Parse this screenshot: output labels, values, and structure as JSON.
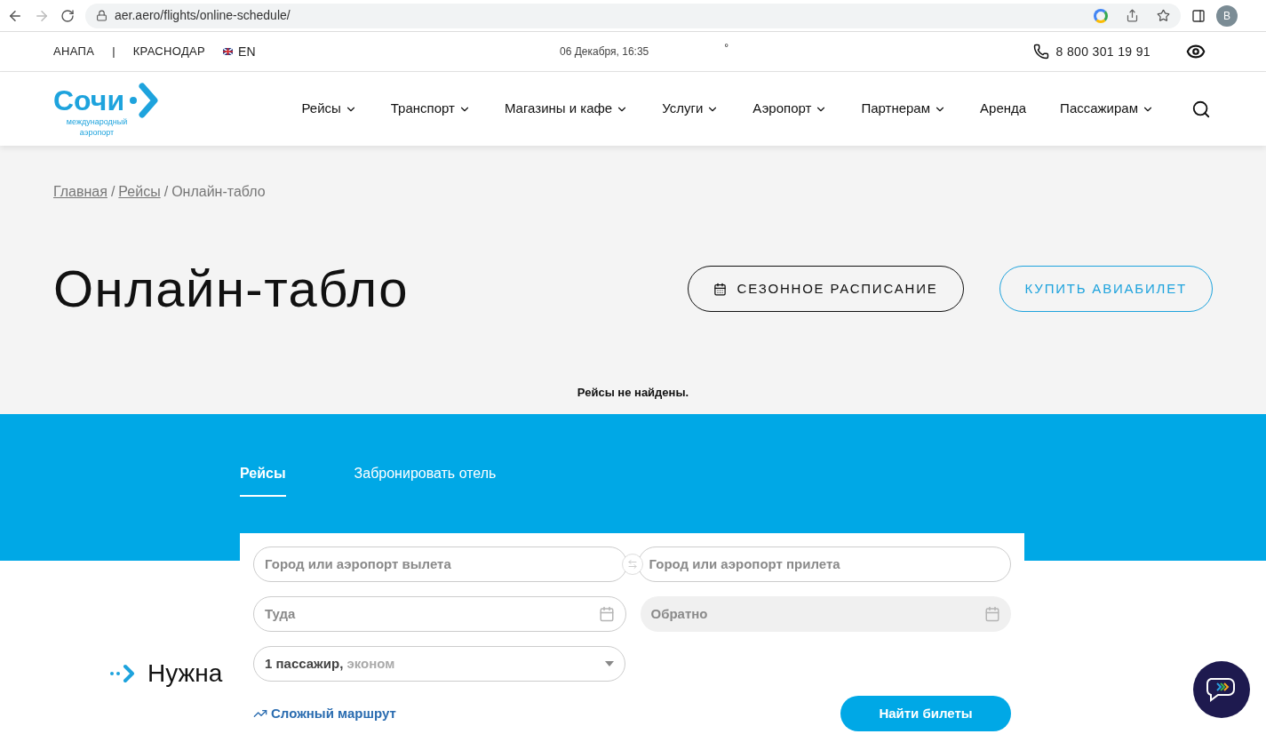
{
  "browser": {
    "url": "aer.aero/flights/online-schedule/",
    "profile_initial": "B"
  },
  "topbar": {
    "cities": [
      "АНАПА",
      "КРАСНОДАР"
    ],
    "separator": "|",
    "language": "EN",
    "datetime": "06 Декабря, 16:35",
    "temperature": "°",
    "phone": "8 800 301 19 91"
  },
  "logo": {
    "name": "Сочи",
    "subtitle": "международный аэропорт"
  },
  "nav": [
    {
      "label": "Рейсы",
      "dropdown": true
    },
    {
      "label": "Транспорт",
      "dropdown": true
    },
    {
      "label": "Магазины и кафе",
      "dropdown": true
    },
    {
      "label": "Услуги",
      "dropdown": true
    },
    {
      "label": "Аэропорт",
      "dropdown": true
    },
    {
      "label": "Партнерам",
      "dropdown": true
    },
    {
      "label": "Аренда",
      "dropdown": false
    },
    {
      "label": "Пассажирам",
      "dropdown": true
    }
  ],
  "breadcrumbs": [
    {
      "kind": "link",
      "label": "Главная"
    },
    {
      "kind": "separator",
      "label": "/"
    },
    {
      "kind": "link",
      "label": "Рейсы"
    },
    {
      "kind": "separator",
      "label": "/"
    },
    {
      "kind": "current",
      "label": "Онлайн-табло"
    }
  ],
  "title": "Онлайн-табло",
  "buttons": [
    {
      "label": "СЕЗОННОЕ РАСПИСАНИЕ",
      "kind": "dark"
    },
    {
      "label": "КУПИТЬ АВИАБИЛЕТ",
      "kind": "blue"
    }
  ],
  "status_message": "Рейсы не найдены.",
  "search_tabs": [
    {
      "label": "Рейсы",
      "selected": true
    },
    {
      "label": "Забронировать отель",
      "selected": false
    }
  ],
  "form": {
    "from": {
      "placeholder": "Город или аэропорт вылета"
    },
    "to": {
      "placeholder": "Город или аэропорт прилета"
    },
    "depart": {
      "placeholder": "Туда",
      "disabled": false
    },
    "return": {
      "placeholder": "Обратно",
      "disabled": true
    },
    "passengers": {
      "value": "1 пассажир,",
      "class": "эконом"
    },
    "complex_route": "Сложный маршрут",
    "submit": "Найти билеты"
  },
  "section_heading": "Нужна"
}
